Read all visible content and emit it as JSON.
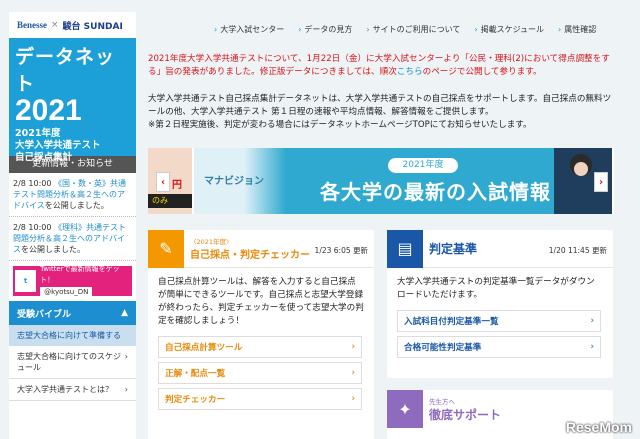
{
  "sidebar": {
    "logo_left": "Benesse",
    "logo_sep": "×",
    "logo_right": "駿台 SUNDAI",
    "hero_title": "データネット",
    "hero_year": "2021",
    "hero_sub1": "2021年度",
    "hero_sub2": "大学入学共通テスト",
    "hero_sub3": "自己採点集計",
    "news_head": "更新情報・お知らせ",
    "news": [
      {
        "date": "2/8 10:00",
        "link": "《国・数・英》共通テスト問題分析＆高２生へのアドバイス",
        "rest": "を公開しました。"
      },
      {
        "date": "2/8 10:00",
        "link": "《理科》共通テスト問題分析＆高２生へのアドバイス",
        "rest": "を公開しました。"
      }
    ],
    "twitter_text": "Twitterで最新情報をゲット！",
    "twitter_handle": "@kyotsu_DN",
    "bible_head": "受験バイブル",
    "bible_sub": "志望大合格に向けて準備する",
    "bible_items": [
      "志望大合格に向けてのスケジュール",
      "大学入学共通テストとは？"
    ]
  },
  "topnav": [
    "大学入試センター",
    "データの見方",
    "サイトのご利用について",
    "掲載スケジュール",
    "属性確認"
  ],
  "notice": {
    "text1": "2021年度大学入学共通テストについて、1月22日（金）に大学入試センターより「公民・理科(2)において得点調整をする」旨の発表がありました。修正版データにつきましては、順次",
    "link": "こちら",
    "text2": "のページで公開して参ります。"
  },
  "intro": [
    "大学入学共通テスト自己採点集計データネットは、大学入学共通テストの自己採点をサポートします。自己採点の無料ツールの他、大学入学共通テスト 第１日程の速報や平均点情報、解答情報をご提供します。",
    "※第２日程実施後、判定が変わる場合にはデータネットホームページTOPにてお知らせいたします。"
  ],
  "banner": {
    "left_red": "円",
    "left_bottom": "のみ",
    "brand": "マナビジョン",
    "pill": "2021年度",
    "title": "各大学の最新の入試情報",
    "prev": "‹",
    "next": "›"
  },
  "card_jiko": {
    "small": "〈2021年度〉",
    "title": "自己採点・判定チェッカー",
    "date": "1/23 6:05 更新",
    "body": "自己採点計算ツールは、解答を入力すると自己採点が簡単にできるツールです。自己採点と志望大学登録が終わったら、判定チェッカーを使って志望大学の判定を確認しましょう！",
    "links": [
      "自己採点計算ツール",
      "正解・配点一覧",
      "判定チェッカー"
    ]
  },
  "card_hantei": {
    "title": "判定基準",
    "date": "1/20 11:45 更新",
    "body": "大学入学共通テストの判定基準一覧データがダウンロードいただけます。",
    "links": [
      "入試科目付判定基準一覧",
      "合格可能性判定基準"
    ]
  },
  "card_sup": {
    "small": "先生方へ",
    "title": "徹底サポート"
  },
  "watermark": "ReseMom",
  "colors": {
    "brand_blue": "#1da0d8",
    "notice_red": "#d7141a",
    "accent_orange": "#f39800",
    "accent_purple": "#8e6bbf"
  }
}
